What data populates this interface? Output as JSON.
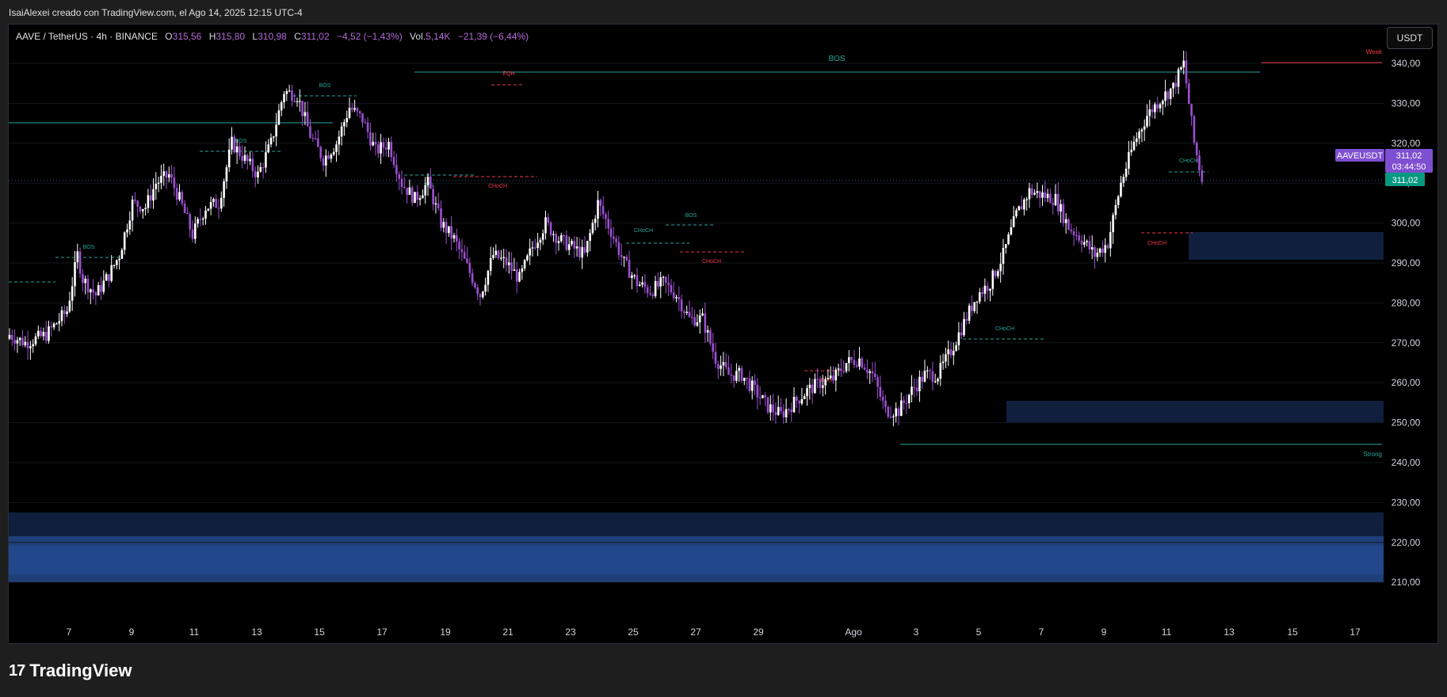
{
  "header": {
    "credit": "IsaiAlexei creado con TradingView.com, el Ago 14, 2025 12:15 UTC-4"
  },
  "legend": {
    "symbol": "AAVE / TetherUS · 4h · BINANCE",
    "open_label": "O",
    "open": "315,56",
    "high_label": "H",
    "high": "315,80",
    "low_label": "L",
    "low": "310,98",
    "close_label": "C",
    "close": "311,02",
    "change": "−4,52 (−1,43%)",
    "vol_label": "Vol.",
    "volume": "5,14K",
    "vol_change": "−21,39 (−6,44%)"
  },
  "currency_button": "USDT",
  "price_axis": {
    "ticks": [
      "340,00",
      "330,00",
      "320,00",
      "310,00",
      "300,00",
      "290,00",
      "280,00",
      "270,00",
      "260,00",
      "250,00",
      "240,00",
      "230,00",
      "220,00",
      "210,00"
    ],
    "tick_values": [
      340,
      330,
      320,
      310,
      300,
      290,
      280,
      270,
      260,
      250,
      240,
      230,
      220,
      210
    ],
    "symbol_tag": "AAVEUSDT",
    "last_price": "311,02",
    "countdown": "03:44:50"
  },
  "time_axis": {
    "ticks": [
      "7",
      "9",
      "11",
      "13",
      "15",
      "17",
      "19",
      "21",
      "23",
      "25",
      "27",
      "29",
      "Ago",
      "3",
      "5",
      "7",
      "9",
      "11",
      "13",
      "15",
      "17"
    ]
  },
  "annotations": {
    "bos": "BOS",
    "choch": "CHoCH",
    "eqh": "EQH",
    "eql": "EQL",
    "weak": "Weak",
    "strong": "Strong"
  },
  "colors": {
    "bull_candle": "#ffffff",
    "bear_candle": "#9c4fd0",
    "teal": "#26a69a",
    "red": "#f23645",
    "zone_blue": "#1f3f7a",
    "tag_purple": "#7e4fd0",
    "tag_green": "#089981"
  },
  "chart_data": {
    "type": "candlestick",
    "symbol": "AAVE / TetherUS",
    "interval": "4h",
    "exchange": "BINANCE",
    "ylim": [
      205,
      344
    ],
    "x_ticks": [
      "7",
      "9",
      "11",
      "13",
      "15",
      "17",
      "19",
      "21",
      "23",
      "25",
      "27",
      "29",
      "Ago",
      "3",
      "5",
      "7",
      "9",
      "11",
      "13",
      "15",
      "17"
    ],
    "last_price": 311.02,
    "close_path": [
      [
        0,
        272
      ],
      [
        6,
        270
      ],
      [
        14,
        272
      ],
      [
        22,
        278
      ],
      [
        26,
        292
      ],
      [
        28,
        286
      ],
      [
        33,
        282
      ],
      [
        38,
        287
      ],
      [
        42,
        292
      ],
      [
        47,
        305
      ],
      [
        52,
        304
      ],
      [
        56,
        310
      ],
      [
        61,
        312
      ],
      [
        65,
        306
      ],
      [
        70,
        297
      ],
      [
        75,
        304
      ],
      [
        80,
        305
      ],
      [
        85,
        320
      ],
      [
        90,
        316
      ],
      [
        95,
        312
      ],
      [
        100,
        320
      ],
      [
        105,
        333
      ],
      [
        110,
        332
      ],
      [
        115,
        322
      ],
      [
        120,
        316
      ],
      [
        125,
        320
      ],
      [
        130,
        329
      ],
      [
        135,
        326
      ],
      [
        140,
        318
      ],
      [
        145,
        320
      ],
      [
        150,
        310
      ],
      [
        155,
        306
      ],
      [
        160,
        310
      ],
      [
        165,
        300
      ],
      [
        170,
        296
      ],
      [
        175,
        289
      ],
      [
        180,
        282
      ],
      [
        185,
        292
      ],
      [
        190,
        290
      ],
      [
        195,
        286
      ],
      [
        200,
        294
      ],
      [
        205,
        300
      ],
      [
        210,
        296
      ],
      [
        215,
        294
      ],
      [
        220,
        292
      ],
      [
        225,
        305
      ],
      [
        230,
        298
      ],
      [
        235,
        290
      ],
      [
        240,
        285
      ],
      [
        245,
        283
      ],
      [
        250,
        285
      ],
      [
        255,
        282
      ],
      [
        260,
        276
      ],
      [
        265,
        276
      ],
      [
        270,
        266
      ],
      [
        275,
        262
      ],
      [
        280,
        262
      ],
      [
        285,
        258
      ],
      [
        290,
        254
      ],
      [
        295,
        252
      ],
      [
        300,
        255
      ],
      [
        305,
        258
      ],
      [
        310,
        260
      ],
      [
        315,
        261
      ],
      [
        320,
        265
      ],
      [
        325,
        266
      ],
      [
        330,
        262
      ],
      [
        335,
        253
      ],
      [
        340,
        253
      ],
      [
        345,
        258
      ],
      [
        350,
        262
      ],
      [
        355,
        262
      ],
      [
        360,
        268
      ],
      [
        365,
        275
      ],
      [
        370,
        282
      ],
      [
        375,
        285
      ],
      [
        380,
        292
      ],
      [
        385,
        302
      ],
      [
        390,
        308
      ],
      [
        395,
        307
      ],
      [
        400,
        306
      ],
      [
        405,
        299
      ],
      [
        410,
        296
      ],
      [
        415,
        292
      ],
      [
        420,
        295
      ],
      [
        425,
        310
      ],
      [
        430,
        320
      ],
      [
        435,
        327
      ],
      [
        440,
        331
      ],
      [
        445,
        334
      ],
      [
        449,
        340
      ],
      [
        451,
        330
      ],
      [
        453,
        320
      ],
      [
        456,
        311
      ]
    ]
  }
}
